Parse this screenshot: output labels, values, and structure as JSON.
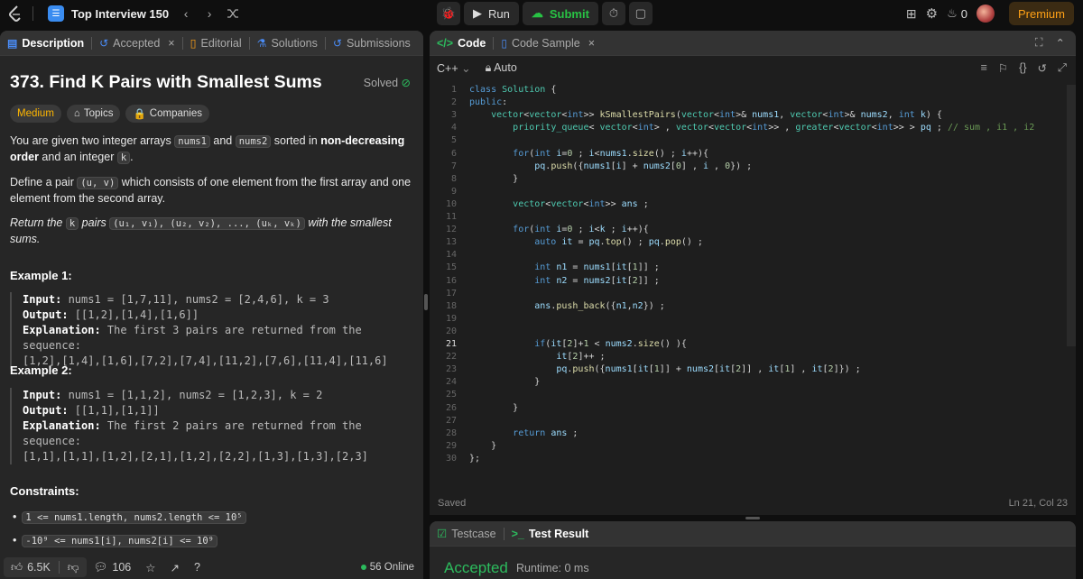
{
  "topbar": {
    "problem_list_title": "Top Interview 150",
    "run_label": "Run",
    "submit_label": "Submit",
    "streak_count": "0",
    "premium_label": "Premium"
  },
  "left_tabs": [
    {
      "label": "Description",
      "icon": "description-icon"
    },
    {
      "label": "Accepted",
      "icon": "history-icon"
    },
    {
      "label": "Editorial",
      "icon": "book-icon"
    },
    {
      "label": "Solutions",
      "icon": "flask-icon"
    },
    {
      "label": "Submissions",
      "icon": "history-icon"
    }
  ],
  "problem": {
    "title": "373. Find K Pairs with Smallest Sums",
    "status": "Solved",
    "difficulty": "Medium",
    "topics_label": "Topics",
    "companies_label": "Companies",
    "p1_a": "You are given two integer arrays ",
    "p1_code1": "nums1",
    "p1_b": " and ",
    "p1_code2": "nums2",
    "p1_c": " sorted in ",
    "p1_bold": "non-decreasing order",
    "p1_d": " and an integer ",
    "p1_code3": "k",
    "p1_e": ".",
    "p2_a": "Define a pair ",
    "p2_code": "(u, v)",
    "p2_b": " which consists of one element from the first array and one element from the second array.",
    "p3_a": "Return the ",
    "p3_code1": "k",
    "p3_b": " pairs ",
    "p3_code2": "(u₁, v₁), (u₂, v₂), ..., (uₖ, vₖ)",
    "p3_c": " with the smallest sums."
  },
  "examples": [
    {
      "title": "Example 1:",
      "input_label": "Input:",
      "input": " nums1 = [1,7,11], nums2 = [2,4,6], k = 3",
      "output_label": "Output:",
      "output": " [[1,2],[1,4],[1,6]]",
      "explanation_label": "Explanation:",
      "explanation": " The first 3 pairs are returned from the sequence:",
      "explanation2": "[1,2],[1,4],[1,6],[7,2],[7,4],[11,2],[7,6],[11,4],[11,6]"
    },
    {
      "title": "Example 2:",
      "input_label": "Input:",
      "input": " nums1 = [1,1,2], nums2 = [1,2,3], k = 2",
      "output_label": "Output:",
      "output": " [[1,1],[1,1]]",
      "explanation_label": "Explanation:",
      "explanation": " The first 2 pairs are returned from the sequence:",
      "explanation2": "[1,1],[1,1],[1,2],[2,1],[1,2],[2,2],[1,3],[1,3],[2,3]"
    }
  ],
  "constraints": {
    "title": "Constraints:",
    "items": [
      "1 <= nums1.length, nums2.length <= 10⁵",
      "-10⁹ <= nums1[i], nums2[i] <= 10⁹"
    ]
  },
  "left_footer": {
    "likes": "6.5K",
    "comments": "106",
    "online": "56 Online"
  },
  "code_tabs": [
    {
      "label": "Code"
    },
    {
      "label": "Code Sample"
    }
  ],
  "editor": {
    "language": "C++",
    "mode": "Auto",
    "saved_label": "Saved",
    "cursor_pos": "Ln 21, Col 23",
    "current_line": 21
  },
  "bottom": {
    "testcase_label": "Testcase",
    "result_label": "Test Result",
    "verdict": "Accepted",
    "runtime": "Runtime: 0 ms"
  }
}
